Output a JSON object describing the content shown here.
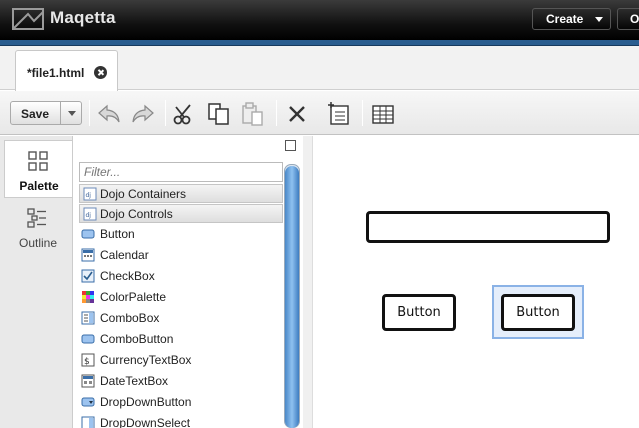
{
  "app": {
    "title": "Maqetta"
  },
  "header": {
    "create_label": "Create",
    "open_label": "Open"
  },
  "tabs": [
    {
      "label": "*file1.html"
    }
  ],
  "toolbar": {
    "save_label": "Save"
  },
  "side_tabs": [
    {
      "label": "Palette",
      "active": true
    },
    {
      "label": "Outline",
      "active": false
    }
  ],
  "palette": {
    "filter_placeholder": "Filter...",
    "groups": [
      {
        "label": "Dojo Containers"
      },
      {
        "label": "Dojo Controls"
      }
    ],
    "items": [
      {
        "label": "Button",
        "icon": "button-widget-icon"
      },
      {
        "label": "Calendar",
        "icon": "calendar-widget-icon"
      },
      {
        "label": "CheckBox",
        "icon": "checkbox-widget-icon"
      },
      {
        "label": "ColorPalette",
        "icon": "colorpalette-widget-icon"
      },
      {
        "label": "ComboBox",
        "icon": "combobox-widget-icon"
      },
      {
        "label": "ComboButton",
        "icon": "combobutton-widget-icon"
      },
      {
        "label": "CurrencyTextBox",
        "icon": "currencytextbox-widget-icon"
      },
      {
        "label": "DateTextBox",
        "icon": "datetextbox-widget-icon"
      },
      {
        "label": "DropDownButton",
        "icon": "dropdownbutton-widget-icon"
      },
      {
        "label": "DropDownSelect",
        "icon": "dropdownselect-widget-icon"
      }
    ]
  },
  "canvas": {
    "buttons": [
      {
        "label": "Button"
      },
      {
        "label": "Button",
        "selected": true
      }
    ]
  },
  "colors": {
    "topbar": "#111111",
    "accent": "#2a5d8f",
    "scroll": "#4a88c8",
    "selection": "#8ab2e6"
  }
}
